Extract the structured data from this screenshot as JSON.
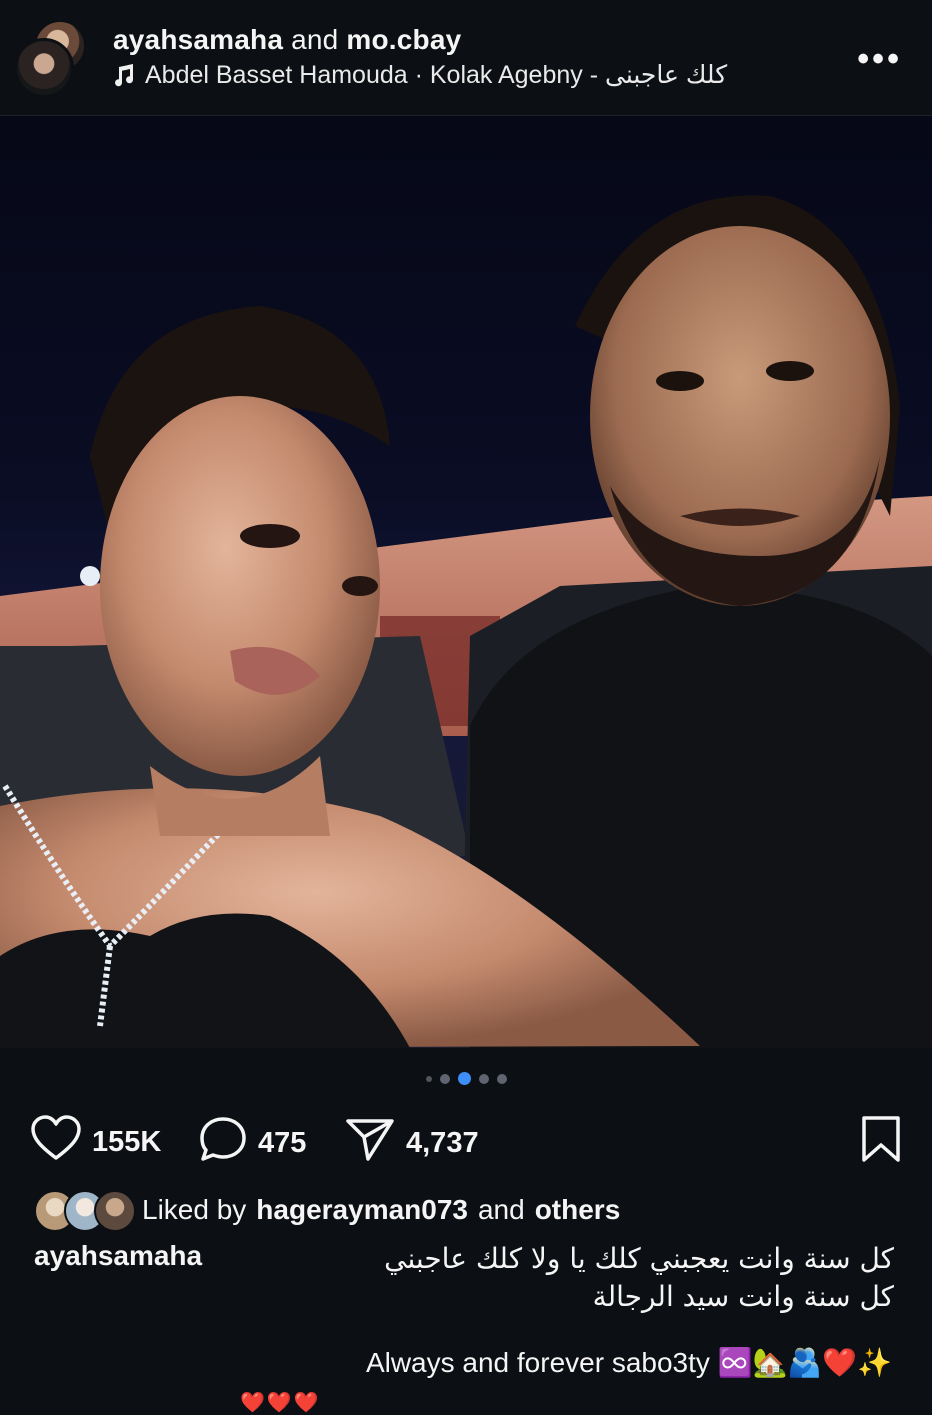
{
  "header": {
    "user1": "ayahsamaha",
    "and": "and",
    "user2": "mo.cbay",
    "audio": "Abdel Basset Hamouda · Kolak Agebny - كلك عاجبنى",
    "more": "•••"
  },
  "actions": {
    "likes": "155K",
    "comments": "475",
    "shares": "4,737"
  },
  "liked_by": {
    "prefix": "Liked by",
    "user": "hagerayman073",
    "and": "and",
    "others": "others"
  },
  "caption": {
    "username": "ayahsamaha",
    "line1": "كل سنة وانت يعجبني كلك يا ولا كلك عاجبني",
    "line2": "كل سنة وانت سيد الرجالة",
    "english": "Always and forever sabo3ty ♾️🏡🫂❤️✨",
    "more_emoji": "❤️❤️❤️"
  },
  "carousel": {
    "count": 5,
    "active_index": 2
  },
  "colors": {
    "accent": "#3d8ef7",
    "background": "#0c0f14"
  }
}
